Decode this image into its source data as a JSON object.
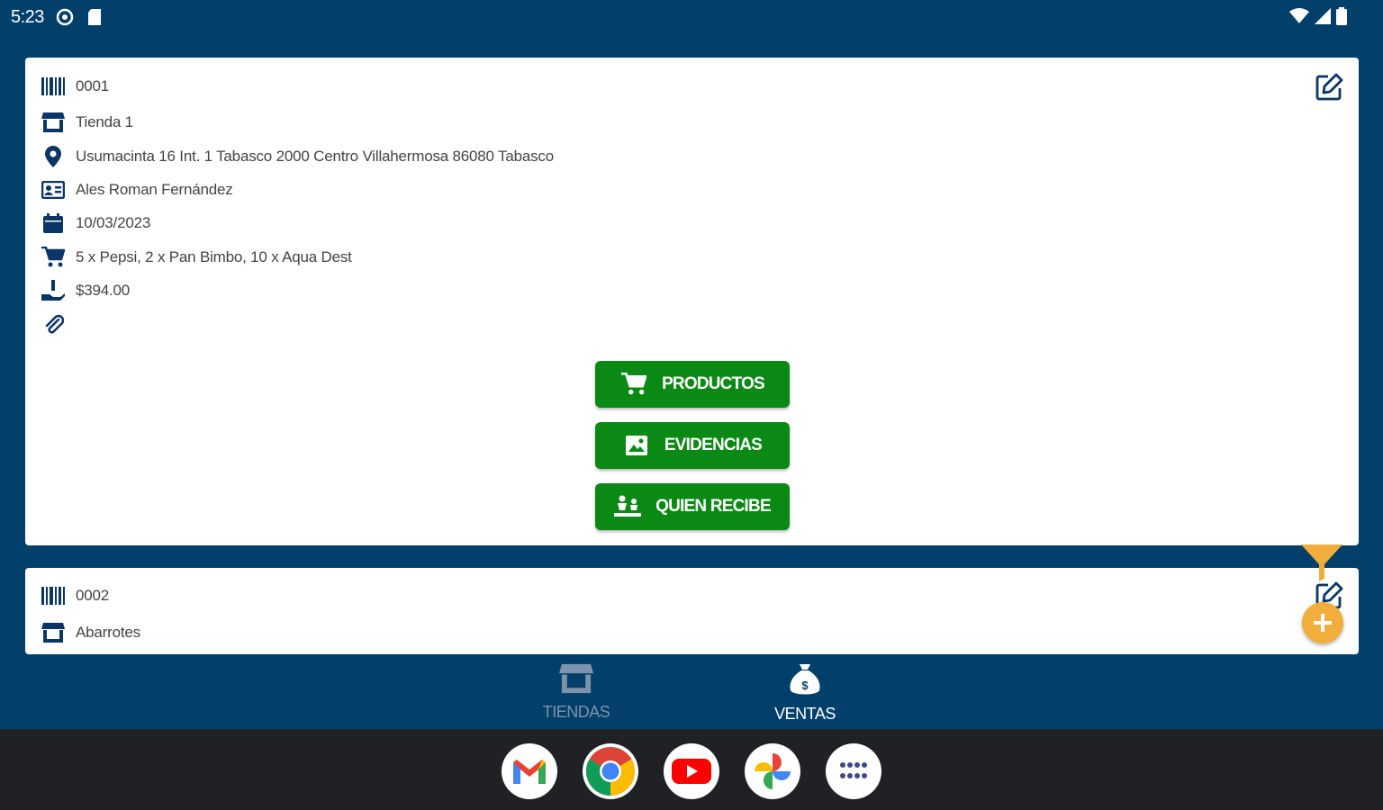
{
  "status_bar": {
    "time": "5:23"
  },
  "colors": {
    "primary": "#023f6b",
    "green": "#0a8a14",
    "accent": "#f2ae3c"
  },
  "cards": [
    {
      "code": "0001",
      "store": "Tienda 1",
      "address": "Usumacinta 16 Int. 1 Tabasco 2000 Centro Villahermosa  86080 Tabasco",
      "contact": "Ales Roman Fernández",
      "date": "10/03/2023",
      "products": "5 x Pepsi, 2 x Pan Bimbo, 10 x Aqua Dest",
      "total": "$394.00",
      "buttons": {
        "productos": "PRODUCTOS",
        "evidencias": "EVIDENCIAS",
        "quien_recibe": "QUIEN RECIBE"
      }
    },
    {
      "code": "0002",
      "store": "Abarrotes"
    }
  ],
  "bottom_nav": {
    "tiendas": "TIENDAS",
    "ventas": "VENTAS"
  },
  "dock_apps": [
    "gmail-icon",
    "chrome-icon",
    "youtube-icon",
    "photos-icon",
    "app-drawer-icon"
  ]
}
